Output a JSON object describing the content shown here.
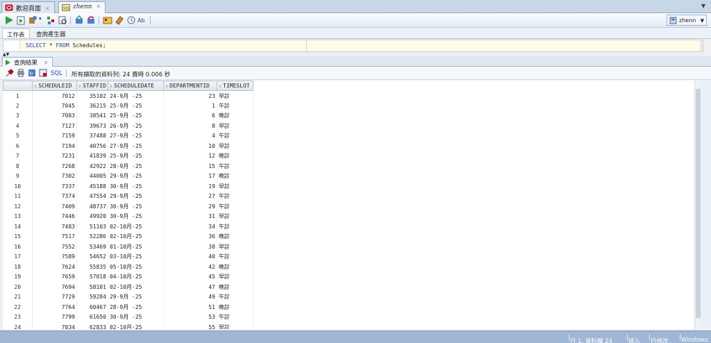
{
  "doc_tabs": [
    {
      "label": "歡迎頁面",
      "active": false
    },
    {
      "label": "zhenn",
      "active": true
    }
  ],
  "connection": {
    "label": "zhenn"
  },
  "worksheet_tabs": [
    "工作表",
    "查詢產生器"
  ],
  "editor": {
    "keyword_select": "SELECT",
    "star": "*",
    "keyword_from": "FROM",
    "rest": "Schedules;"
  },
  "result": {
    "tab_label": "查詢結果",
    "sql_link": "SQL",
    "status": "所有擷取的資料列: 24 費時 0.006 秒",
    "columns": [
      "SCHEDULEID",
      "STAFFID",
      "SCHEDULEDATE",
      "DEPARTMENTID",
      "TIMESLOT"
    ],
    "rows": [
      [
        "1",
        "7012",
        "35102",
        "24-9月 -25",
        "23",
        "早診"
      ],
      [
        "2",
        "7045",
        "36215",
        "25-9月 -25",
        "1",
        "午診"
      ],
      [
        "3",
        "7083",
        "38541",
        "25-9月 -25",
        "6",
        "晚診"
      ],
      [
        "4",
        "7127",
        "39673",
        "26-9月 -25",
        "8",
        "早診"
      ],
      [
        "5",
        "7159",
        "37488",
        "27-9月 -25",
        "4",
        "午診"
      ],
      [
        "6",
        "7194",
        "40756",
        "27-9月 -25",
        "10",
        "早診"
      ],
      [
        "7",
        "7231",
        "41839",
        "25-9月 -25",
        "12",
        "晚診"
      ],
      [
        "8",
        "7268",
        "42922",
        "28-9月 -25",
        "15",
        "午診"
      ],
      [
        "9",
        "7302",
        "44005",
        "29-9月 -25",
        "17",
        "晚診"
      ],
      [
        "10",
        "7337",
        "45188",
        "30-9月 -25",
        "19",
        "早診"
      ],
      [
        "11",
        "7374",
        "47554",
        "29-9月 -25",
        "27",
        "午診"
      ],
      [
        "12",
        "7409",
        "48737",
        "30-9月 -25",
        "29",
        "午診"
      ],
      [
        "13",
        "7446",
        "49920",
        "30-9月 -25",
        "31",
        "早診"
      ],
      [
        "14",
        "7483",
        "51103",
        "02-10月-25",
        "34",
        "午診"
      ],
      [
        "15",
        "7517",
        "52286",
        "02-10月-25",
        "36",
        "晚診"
      ],
      [
        "16",
        "7552",
        "53469",
        "01-10月-25",
        "38",
        "早診"
      ],
      [
        "17",
        "7589",
        "54652",
        "03-10月-25",
        "40",
        "午診"
      ],
      [
        "18",
        "7624",
        "55835",
        "05-10月-25",
        "42",
        "晚診"
      ],
      [
        "19",
        "7659",
        "57018",
        "04-10月-25",
        "45",
        "早診"
      ],
      [
        "20",
        "7694",
        "58101",
        "02-10月-25",
        "47",
        "晚診"
      ],
      [
        "21",
        "7729",
        "59284",
        "29-9月 -25",
        "49",
        "午診"
      ],
      [
        "22",
        "7764",
        "60467",
        "28-9月 -25",
        "51",
        "晚診"
      ],
      [
        "23",
        "7799",
        "61650",
        "30-9月 -25",
        "53",
        "午診"
      ],
      [
        "24",
        "7834",
        "62833",
        "02-10月-25",
        "55",
        "早診"
      ]
    ]
  },
  "statusbar": {
    "position": "行 1, 資料欄 24",
    "mode": "插入",
    "modified": "已修改",
    "os": "Windows: CR"
  }
}
